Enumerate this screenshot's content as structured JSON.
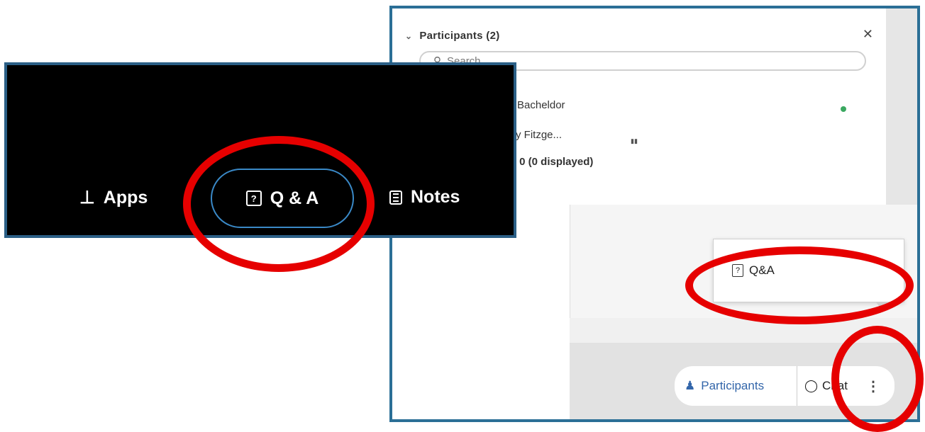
{
  "panel": {
    "header": "Participants (2)",
    "close_icon": "close-icon",
    "search_placeholder": "Search",
    "section_count": "2",
    "participant_1": "Bacheldor",
    "participant_2": "y Fitzge...",
    "attendees": ": 0 (0 displayed)"
  },
  "toolbar": {
    "apps_label": "Apps",
    "qa_label": "Q & A",
    "notes_label": "Notes"
  },
  "overlay": {
    "menu_qa_label": "Q&A",
    "tab_participants": "Participants",
    "tab_chat": "Chat",
    "more_icon": "more-vertical-icon"
  },
  "colors": {
    "highlight": "#e60000",
    "toolbar_bg": "#000000",
    "qa_pill_border": "#3a89c7",
    "panel_border": "#2b6f96"
  }
}
